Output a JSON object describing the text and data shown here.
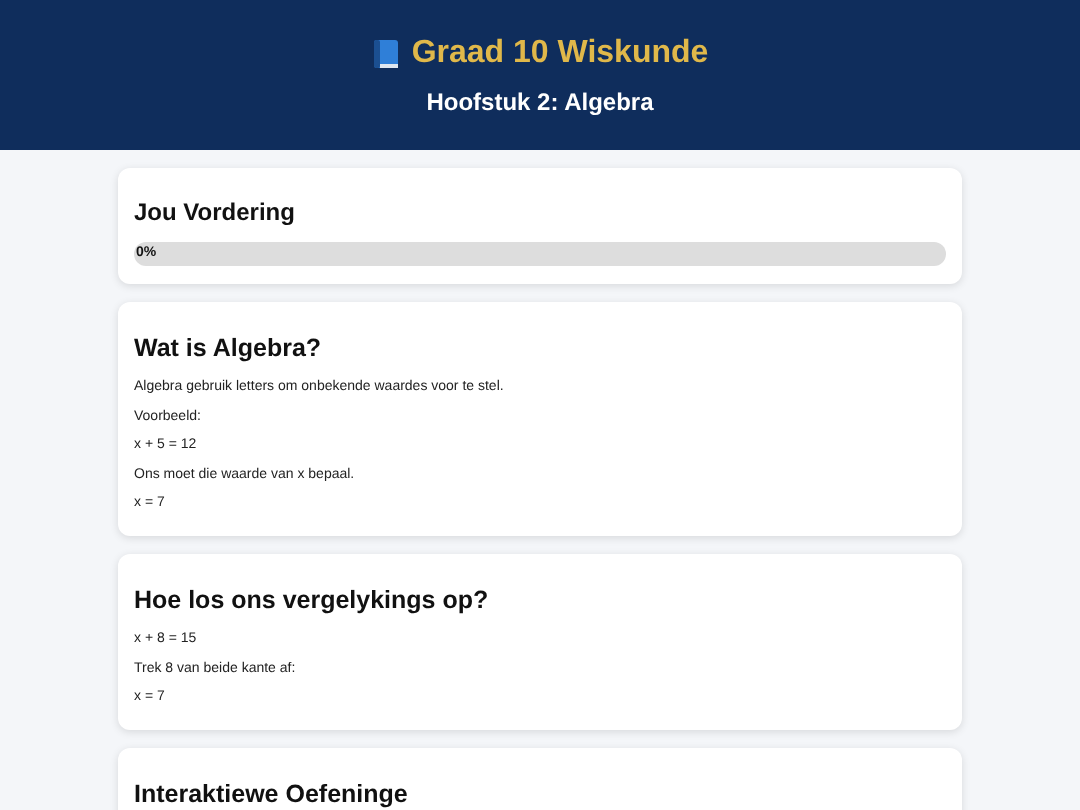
{
  "header": {
    "title": "Graad 10 Wiskunde",
    "subtitle": "Hoofstuk 2: Algebra"
  },
  "progress": {
    "title": "Jou Vordering",
    "level": 0,
    "reading": "0%"
  },
  "sections": [
    {
      "title": "Wat is Algebra?",
      "lines": [
        "Algebra gebruik letters om onbekende waardes voor te stel.",
        "Voorbeeld:",
        "x + 5 = 12",
        "Ons moet die waarde van x bepaal.",
        "x = 7"
      ]
    },
    {
      "title": "Hoe los ons vergelykings op?",
      "lines": [
        "x + 8 = 15",
        "Trek 8 van beide kante af:",
        "x = 7"
      ]
    },
    {
      "title": "Interaktiewe Oefeninge"
    }
  ]
}
